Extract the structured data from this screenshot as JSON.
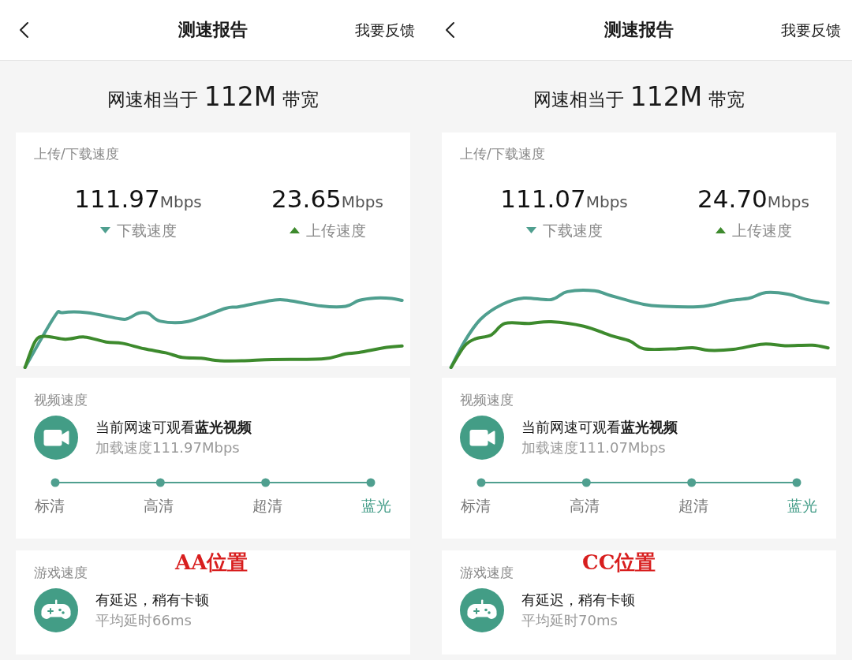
{
  "screens": [
    {
      "header": {
        "title": "测速报告",
        "action": "我要反馈"
      },
      "bandwidth": {
        "prefix": "网速相当于",
        "value": "112M",
        "suffix": "带宽"
      },
      "speed": {
        "title": "上传/下载速度",
        "metrics": [
          {
            "kind": "download",
            "value": "111.97",
            "unit": "Mbps",
            "label": "下载速度",
            "color": "#4f9f8f"
          },
          {
            "kind": "upload",
            "value": "23.65",
            "unit": "Mbps",
            "label": "上传速度",
            "color": "#3d8a2d"
          }
        ]
      },
      "video": {
        "title": "视频速度",
        "headline": "当前网速可观看**蓝光视频**",
        "detail": "加载速度111.97Mbps",
        "qualities": [
          {
            "label": "标清",
            "selected": false
          },
          {
            "label": "高清",
            "selected": false
          },
          {
            "label": "超清",
            "selected": false
          },
          {
            "label": "蓝光",
            "selected": true
          }
        ]
      },
      "game": {
        "title": "游戏速度",
        "headline": "有延迟，稍有卡顿",
        "detail": "平均延时66ms"
      },
      "annotation": "AA位置"
    },
    {
      "header": {
        "title": "测速报告",
        "action": "我要反馈"
      },
      "bandwidth": {
        "prefix": "网速相当于",
        "value": "112M",
        "suffix": "带宽"
      },
      "speed": {
        "title": "上传/下载速度",
        "metrics": [
          {
            "kind": "download",
            "value": "111.07",
            "unit": "Mbps",
            "label": "下载速度",
            "color": "#4f9f8f"
          },
          {
            "kind": "upload",
            "value": "24.70",
            "unit": "Mbps",
            "label": "上传速度",
            "color": "#3d8a2d"
          }
        ]
      },
      "video": {
        "title": "视频速度",
        "headline": "当前网速可观看**蓝光视频**",
        "detail": "加载速度111.07Mbps",
        "qualities": [
          {
            "label": "标清",
            "selected": false
          },
          {
            "label": "高清",
            "selected": false
          },
          {
            "label": "超清",
            "selected": false
          },
          {
            "label": "蓝光",
            "selected": true
          }
        ]
      },
      "game": {
        "title": "游戏速度",
        "headline": "有延迟，稍有卡顿",
        "detail": "平均延时70ms"
      },
      "annotation": "CC位置"
    }
  ]
}
